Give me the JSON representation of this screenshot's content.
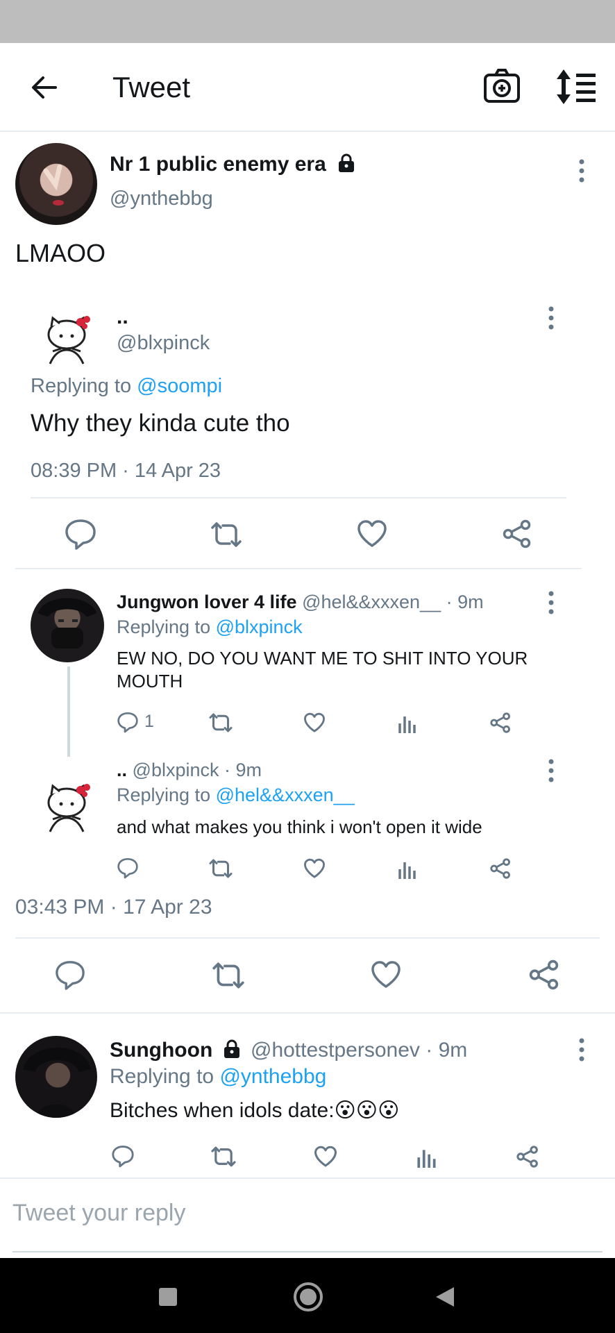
{
  "header": {
    "title": "Tweet"
  },
  "main_tweet": {
    "display_name": "Nr 1 public enemy era",
    "handle": "@ynthebbg",
    "text": "LMAOO",
    "quoted": {
      "display_name": "..",
      "handle": "@blxpinck",
      "replying_to_label": "Replying to",
      "replying_to": "@soompi",
      "text": "Why they kinda cute tho",
      "timestamp": "08:39 PM · 14 Apr 23"
    },
    "thread": [
      {
        "display_name": "Jungwon lover 4 life",
        "meta": "@hel&&xxxen__ · 9m",
        "replying_to_label": "Replying to",
        "replying_to": "@blxpinck",
        "text": "EW NO, DO YOU WANT ME TO SHIT INTO YOUR MOUTH",
        "reply_count": "1"
      },
      {
        "display_name": "..",
        "meta": "@blxpinck · 9m",
        "replying_to_label": "Replying to",
        "replying_to": "@hel&&xxxen__",
        "text": "and what makes you think i won't open it wide"
      }
    ],
    "timestamp": "03:43 PM · 17 Apr 23"
  },
  "reply": {
    "display_name": "Sunghoon",
    "meta": "@hottestpersonev · 9m",
    "replying_to_label": "Replying to",
    "replying_to": "@ynthebbg",
    "text": "Bitches when idols date:😮😮😮"
  },
  "composer": {
    "placeholder": "Tweet your reply"
  },
  "colors": {
    "link": "#1da1f2",
    "text": "#14171a",
    "muted": "#657786",
    "divider": "#e6ecf0"
  }
}
